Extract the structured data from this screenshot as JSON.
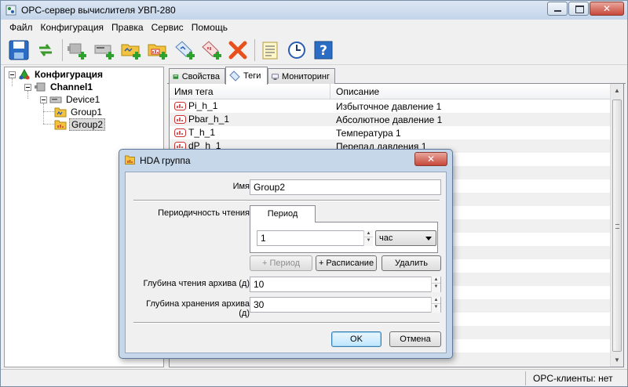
{
  "window": {
    "title": "OPC-сервер вычислителя УВП-280"
  },
  "menu": [
    "Файл",
    "Конфигурация",
    "Правка",
    "Сервис",
    "Помощь"
  ],
  "toolbar": {
    "buttons": [
      "save-icon",
      "refresh-icon",
      "add-channel-icon",
      "add-device-icon",
      "add-group-icon",
      "add-hda-group-icon",
      "add-tag-icon",
      "add-hda-tag-icon",
      "delete-icon",
      "log-icon",
      "clock-icon",
      "help-icon"
    ],
    "help_glyph": "?"
  },
  "tree": {
    "root": "Конфигурация",
    "channel": "Channel1",
    "device": "Device1",
    "groups": [
      "Group1",
      "Group2"
    ]
  },
  "tabs": [
    "Свойства",
    "Теги",
    "Мониторинг"
  ],
  "grid": {
    "columns": [
      "Имя тега",
      "Описание"
    ],
    "rows": [
      {
        "name": "Pi_h_1",
        "desc": "Избыточное давление 1"
      },
      {
        "name": "Pbar_h_1",
        "desc": "Абсолютное давление 1"
      },
      {
        "name": "T_h_1",
        "desc": "Температура 1"
      },
      {
        "name": "dP_h_1",
        "desc": "Перепад давления 1"
      }
    ]
  },
  "status": {
    "clients": "OPC-клиенты: нет"
  },
  "dialog": {
    "title": "HDA группа",
    "close_glyph": "✕",
    "name_label": "Имя",
    "name_value": "Group2",
    "period_label": "Периодичность чтения",
    "period_tab": "Период",
    "period_value": "1",
    "period_unit": "час",
    "btn_add_period": "+ Период",
    "btn_add_schedule": "+ Расписание",
    "btn_delete": "Удалить",
    "read_depth_label": "Глубина чтения архива (д)",
    "read_depth_value": "10",
    "store_depth_label": "Глубина хранения архива (д)",
    "store_depth_value": "30",
    "ok": "OK",
    "cancel": "Отмена"
  },
  "colors": {
    "accent": "#3c7fb1",
    "titlebar": "#c4d5ea",
    "delete": "#e8501e"
  }
}
